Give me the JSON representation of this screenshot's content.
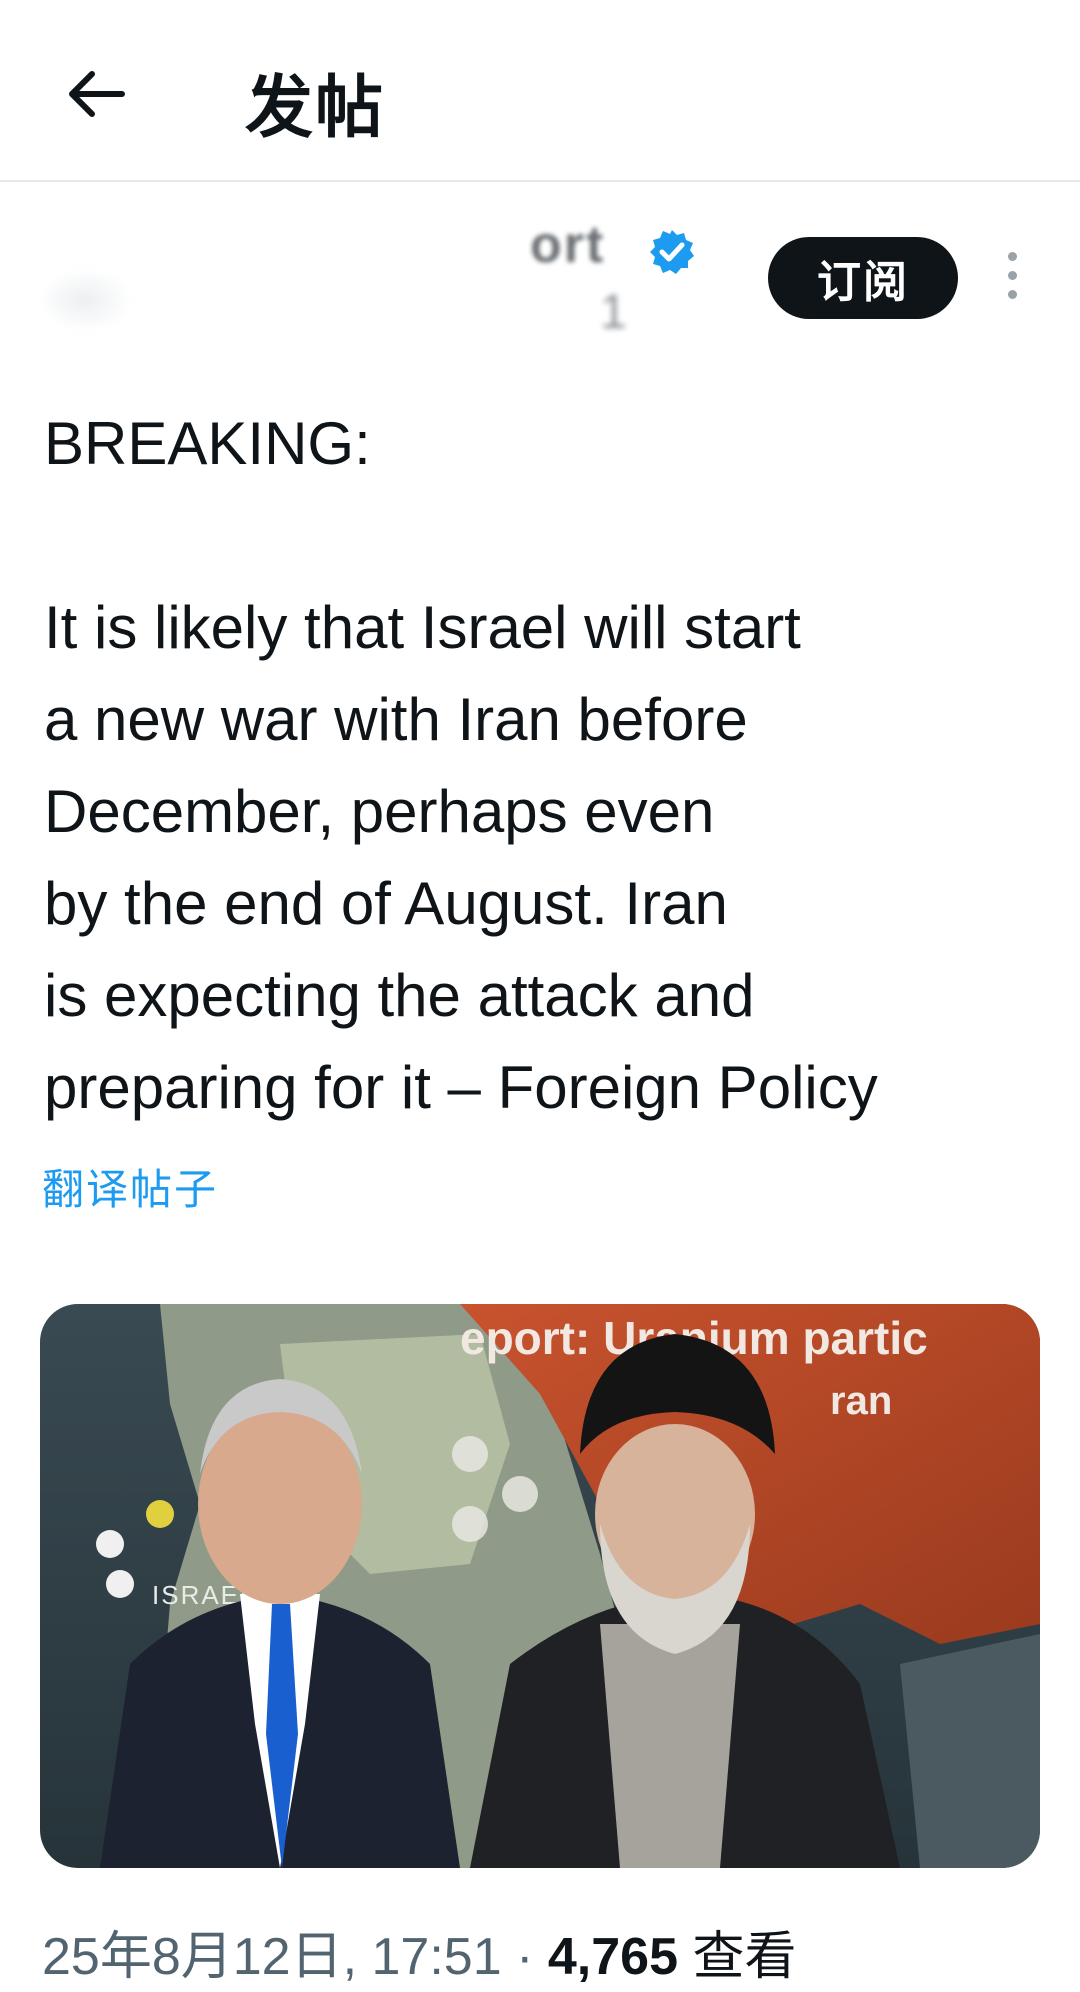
{
  "header": {
    "title": "发帖",
    "back_icon": "arrow-left-icon"
  },
  "author": {
    "handle_fragment": "ort",
    "handle_sub_fragment": "1",
    "verified_icon": "verified-badge-icon",
    "subscribe_label": "订阅",
    "more_icon": "more-vertical-icon"
  },
  "post": {
    "heading": "BREAKING:",
    "lines": [
      "It is likely that Israel will start",
      "a new war with Iran before",
      "December, perhaps even",
      "by the end of August. Iran",
      "is expecting the attack and",
      "preparing for it – Foreign Policy"
    ],
    "translate_label": "翻译帖子"
  },
  "media": {
    "overlay_line1": "eport: Uranium partic",
    "overlay_line2": "ran",
    "map_label": "ISRAEL"
  },
  "meta": {
    "timestamp": "25年8月12日, 17:51",
    "separator": "·",
    "views_count": "4,765",
    "views_label": "查看"
  },
  "colors": {
    "link": "#1d9bf0",
    "text": "#0f1419",
    "muted": "#536471",
    "button_bg": "#0f1419"
  }
}
